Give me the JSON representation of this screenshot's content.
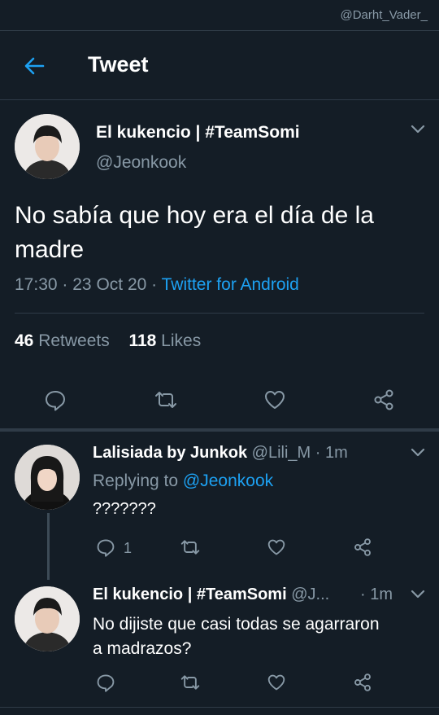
{
  "watermark": "@Darht_Vader_",
  "header": {
    "title": "Tweet"
  },
  "main_tweet": {
    "display_name": "El kukencio | #TeamSomi",
    "handle": "@Jeonkook",
    "text": "No sabía que hoy era el día de la madre",
    "time": "17:30",
    "sep1": "·",
    "date": "23 Oct 20",
    "sep2": "·",
    "source": "Twitter for Android",
    "retweets_count": "46",
    "retweets_label": "Retweets",
    "likes_count": "118",
    "likes_label": "Likes"
  },
  "replies": [
    {
      "display_name": "Lalisiada by Junkok",
      "handle": "@Lili_M",
      "time": "· 1m",
      "replying_label": "Replying to",
      "replying_handle": "@Jeonkook",
      "text": "???????",
      "reply_count": "1"
    },
    {
      "display_name": "El kukencio | #TeamSomi",
      "handle": "@J...",
      "time": "· 1m",
      "text_line1": "No dijiste que casi todas se agarraron",
      "text_line2": "a madrazos?"
    }
  ],
  "colors": {
    "background": "#141d26",
    "accent": "#1da1f2",
    "muted": "#8899a6",
    "divider": "#2f3b47"
  },
  "icons": [
    "back-arrow-icon",
    "chevron-down-icon",
    "reply-icon",
    "retweet-icon",
    "like-icon",
    "share-icon"
  ]
}
